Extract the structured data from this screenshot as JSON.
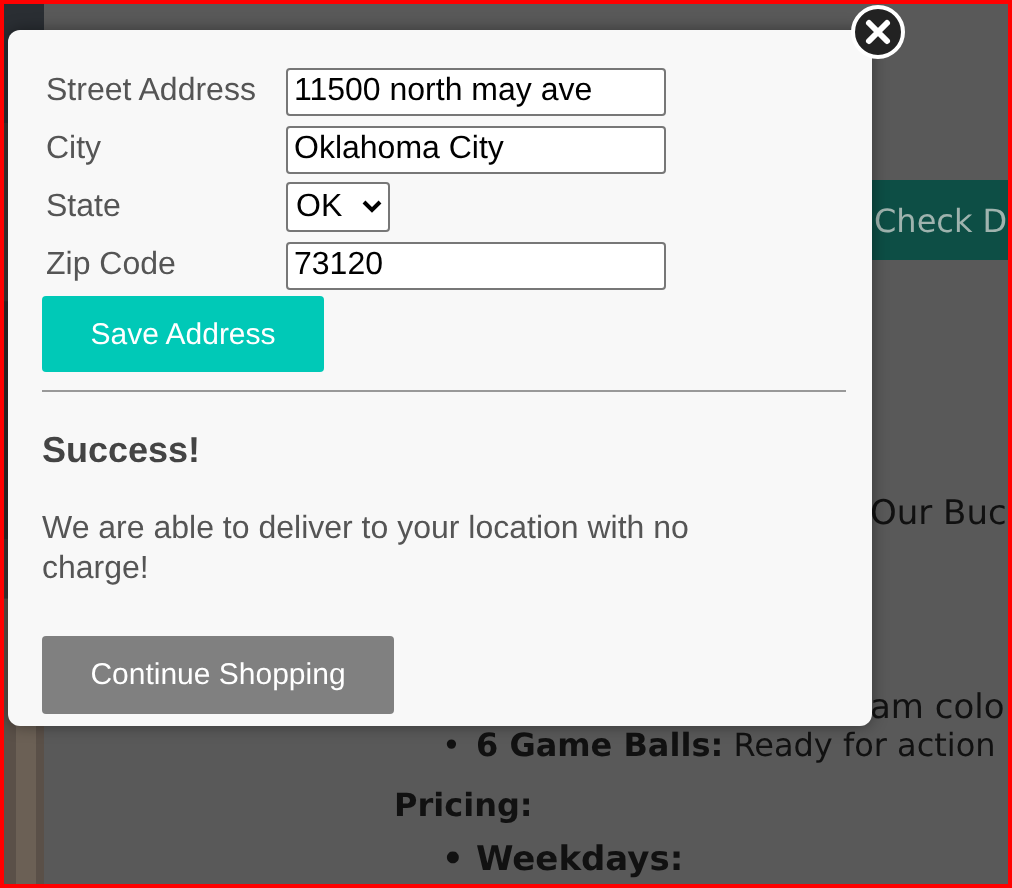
{
  "page": {
    "check_button": "Check D",
    "text_1": "Our Buc",
    "text_2": "am colo",
    "features": [
      {
        "marker": "•",
        "label": "6 Game Balls:",
        "text": "Ready for action"
      }
    ],
    "pricing_heading": "Pricing:",
    "pricing": [
      {
        "marker": "•",
        "label": "Weekdays:"
      }
    ]
  },
  "modal": {
    "fields": [
      {
        "label": "Street Address",
        "kind": "text",
        "value": "11500 north may ave"
      },
      {
        "label": "City",
        "kind": "text",
        "value": "Oklahoma City"
      },
      {
        "label": "State",
        "kind": "select",
        "value": "OK"
      },
      {
        "label": "Zip Code",
        "kind": "text",
        "value": "73120"
      }
    ],
    "save_button": "Save Address",
    "status_title": "Success!",
    "message": "We are able to deliver to your location with no charge!",
    "continue_button": "Continue Shopping"
  }
}
